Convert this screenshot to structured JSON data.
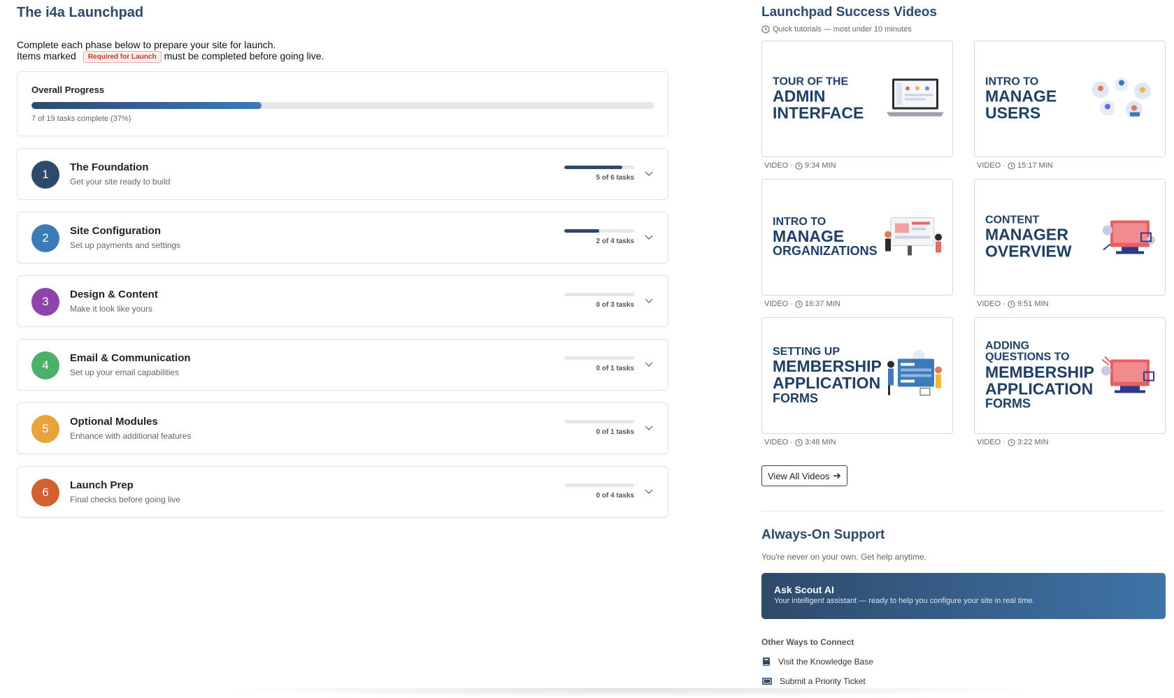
{
  "launchpad": {
    "title": "The i4a Launchpad",
    "intro_line1": "Complete each phase below to prepare your site for launch.",
    "intro_line2_pre": "Items marked",
    "required_badge": "Required for Launch",
    "intro_line2_post": "must be completed before going live.",
    "overall": {
      "label": "Overall Progress",
      "summary": "7 of 19 tasks complete (37%)",
      "progress": 0.37
    },
    "phases": [
      {
        "num": "1",
        "title": "The Foundation",
        "desc": "Get your site ready to build",
        "count": "5 of 6 tasks",
        "progress": 0.83,
        "color": "#2e4a6b"
      },
      {
        "num": "2",
        "title": "Site Configuration",
        "desc": "Set up payments and settings",
        "count": "2 of 4 tasks",
        "progress": 0.5,
        "color": "#3d7ab8"
      },
      {
        "num": "3",
        "title": "Design & Content",
        "desc": "Make it look like yours",
        "count": "0 of 3 tasks",
        "progress": 0,
        "color": "#8e44ad"
      },
      {
        "num": "4",
        "title": "Email & Communication",
        "desc": "Set up your email capabilities",
        "count": "0 of 1 tasks",
        "progress": 0,
        "color": "#4caf6a"
      },
      {
        "num": "5",
        "title": "Optional Modules",
        "desc": "Enhance with additional features",
        "count": "0 of 1 tasks",
        "progress": 0,
        "color": "#e8a33c"
      },
      {
        "num": "6",
        "title": "Launch Prep",
        "desc": "Final checks before going live",
        "count": "0 of 4 tasks",
        "progress": 0,
        "color": "#d4602e"
      }
    ]
  },
  "videos": {
    "title": "Launchpad Success Videos",
    "subtitle": "Quick tutorials — most under 10 minutes",
    "items": [
      {
        "l1": "TOUR OF THE",
        "l2": "ADMIN",
        "l3": "INTERFACE",
        "meta": "VIDEO · ",
        "duration": "9:34 MIN",
        "art": "laptop-illustration"
      },
      {
        "l1": "INTRO TO",
        "l2": "MANAGE",
        "l3": "USERS",
        "meta": "VIDEO · ",
        "duration": "15:17 MIN",
        "art": "users-illustration"
      },
      {
        "l1": "INTRO TO",
        "l2": "MANAGE",
        "l3": "ORGANIZATIONS",
        "meta": "VIDEO · ",
        "duration": "16:37 MIN",
        "art": "organizations-illustration"
      },
      {
        "l1": "CONTENT",
        "l2": "MANAGER",
        "l3": "OVERVIEW",
        "meta": "VIDEO · ",
        "duration": "9:51 MIN",
        "art": "content-illustration"
      },
      {
        "l1": "SETTING UP",
        "l2": "MEMBERSHIP",
        "l3": "APPLICATION",
        "l4": "FORMS",
        "meta": "VIDEO · ",
        "duration": "3:48 MIN",
        "art": "forms-illustration"
      },
      {
        "l1": "ADDING QUESTIONS TO",
        "l2": "MEMBERSHIP",
        "l3": "APPLICATION",
        "l4": "FORMS",
        "meta": "VIDEO · ",
        "duration": "3:22 MIN",
        "art": "questions-illustration"
      }
    ],
    "view_all": "View All Videos"
  },
  "support": {
    "title": "Always-On Support",
    "subtitle": "You're never on your own. Get help anytime.",
    "scout_title": "Ask Scout AI",
    "scout_desc": "Your intelligent assistant — ready to help you configure your site in real time.",
    "other_heading": "Other Ways to Connect",
    "links": [
      "Visit the Knowledge Base",
      "Submit a Priority Ticket"
    ]
  },
  "colors": {
    "heading": "#2e4a6b",
    "accent": "#3d7ab8",
    "required": "#c0392b"
  }
}
